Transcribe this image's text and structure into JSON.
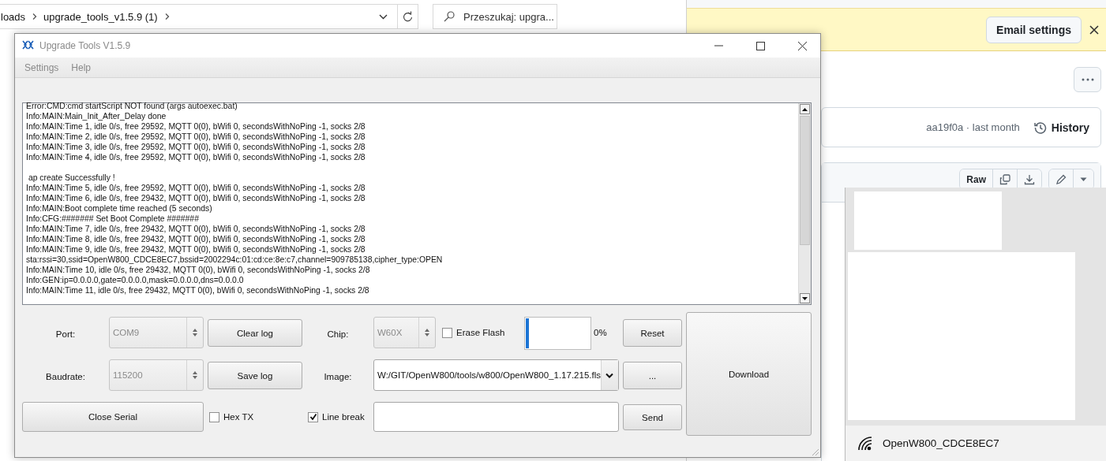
{
  "explorer": {
    "breadcrumbs": [
      "loads",
      "upgrade_tools_v1.5.9 (1)"
    ],
    "search": {
      "placeholder": "Przeszukaj: upgra..."
    }
  },
  "browser": {
    "banner": {
      "button": "Email settings"
    },
    "commit": {
      "text": "aa19f0a · last month",
      "history": "History"
    },
    "file_toolbar": {
      "raw": "Raw"
    }
  },
  "app": {
    "title": "Upgrade Tools V1.5.9",
    "menu": [
      "Settings",
      "Help"
    ],
    "log": [
      {
        "kind": "text",
        "text": "Error:CMD:cmd startScript NOT found (args autoexec.bat)"
      },
      {
        "kind": "text",
        "text": "Info:MAIN:Main_Init_After_Delay done"
      },
      {
        "kind": "text",
        "text": "Info:MAIN:Time 1, idle 0/s, free 29592, MQTT 0(0), bWifi 0, secondsWithNoPing -1, socks 2/8"
      },
      {
        "kind": "text",
        "text": "Info:MAIN:Time 2, idle 0/s, free 29592, MQTT 0(0), bWifi 0, secondsWithNoPing -1, socks 2/8"
      },
      {
        "kind": "text",
        "text": "Info:MAIN:Time 3, idle 0/s, free 29592, MQTT 0(0), bWifi 0, secondsWithNoPing -1, socks 2/8"
      },
      {
        "kind": "text",
        "text": "Info:MAIN:Time 4, idle 0/s, free 29592, MQTT 0(0), bWifi 0, secondsWithNoPing -1, socks 2/8"
      },
      {
        "kind": "blank"
      },
      {
        "kind": "text",
        "text": " ap create Successfully !"
      },
      {
        "kind": "text",
        "text": "Info:MAIN:Time 5, idle 0/s, free 29592, MQTT 0(0), bWifi 0, secondsWithNoPing -1, socks 2/8"
      },
      {
        "kind": "text",
        "text": "Info:MAIN:Time 6, idle 0/s, free 29432, MQTT 0(0), bWifi 0, secondsWithNoPing -1, socks 2/8"
      },
      {
        "kind": "text",
        "text": "Info:MAIN:Boot complete time reached (5 seconds)"
      },
      {
        "kind": "text",
        "text": "Info:CFG:####### Set Boot Complete #######"
      },
      {
        "kind": "text",
        "text": "Info:MAIN:Time 7, idle 0/s, free 29432, MQTT 0(0), bWifi 0, secondsWithNoPing -1, socks 2/8"
      },
      {
        "kind": "text",
        "text": "Info:MAIN:Time 8, idle 0/s, free 29432, MQTT 0(0), bWifi 0, secondsWithNoPing -1, socks 2/8"
      },
      {
        "kind": "text",
        "text": "Info:MAIN:Time 9, idle 0/s, free 29432, MQTT 0(0), bWifi 0, secondsWithNoPing -1, socks 2/8"
      },
      {
        "kind": "text",
        "text": "sta:rssi=30,ssid=OpenW800_CDCE8EC7,bssid=2002294c:01:cd:ce:8e:c7,channel=909785138,cipher_type:OPEN"
      },
      {
        "kind": "text",
        "text": "Info:MAIN:Time 10, idle 0/s, free 29432, MQTT 0(0), bWifi 0, secondsWithNoPing -1, socks 2/8"
      },
      {
        "kind": "text",
        "text": "Info:GEN:ip=0.0.0.0,gate=0.0.0.0,mask=0.0.0.0,dns=0.0.0.0"
      },
      {
        "kind": "text",
        "text": "Info:MAIN:Time 11, idle 0/s, free 29432, MQTT 0(0), bWifi 0, secondsWithNoPing -1, socks 2/8"
      }
    ],
    "port": {
      "label": "Port:",
      "value": "COM9",
      "disabled": true
    },
    "baudrate": {
      "label": "Baudrate:",
      "value": "115200",
      "disabled": true
    },
    "clear_log": "Clear log",
    "save_log": "Save log",
    "close_serial": "Close Serial",
    "hex_tx": {
      "label": "Hex TX",
      "checked": false
    },
    "chip": {
      "label": "Chip:",
      "value": "W60X",
      "disabled": true
    },
    "erase_flash": {
      "label": "Erase Flash",
      "checked": false
    },
    "image": {
      "label": "Image:",
      "value": "W:/GIT/OpenW800/tools/w800/OpenW800_1.17.215.fls"
    },
    "line_break": {
      "label": "Line break",
      "checked": true
    },
    "progress": {
      "level": 0.05,
      "text": "0%"
    },
    "reset": "Reset",
    "browse": "...",
    "send": "Send",
    "download": "Download"
  },
  "wifi": {
    "network": "OpenW800_CDCE8EC7"
  }
}
